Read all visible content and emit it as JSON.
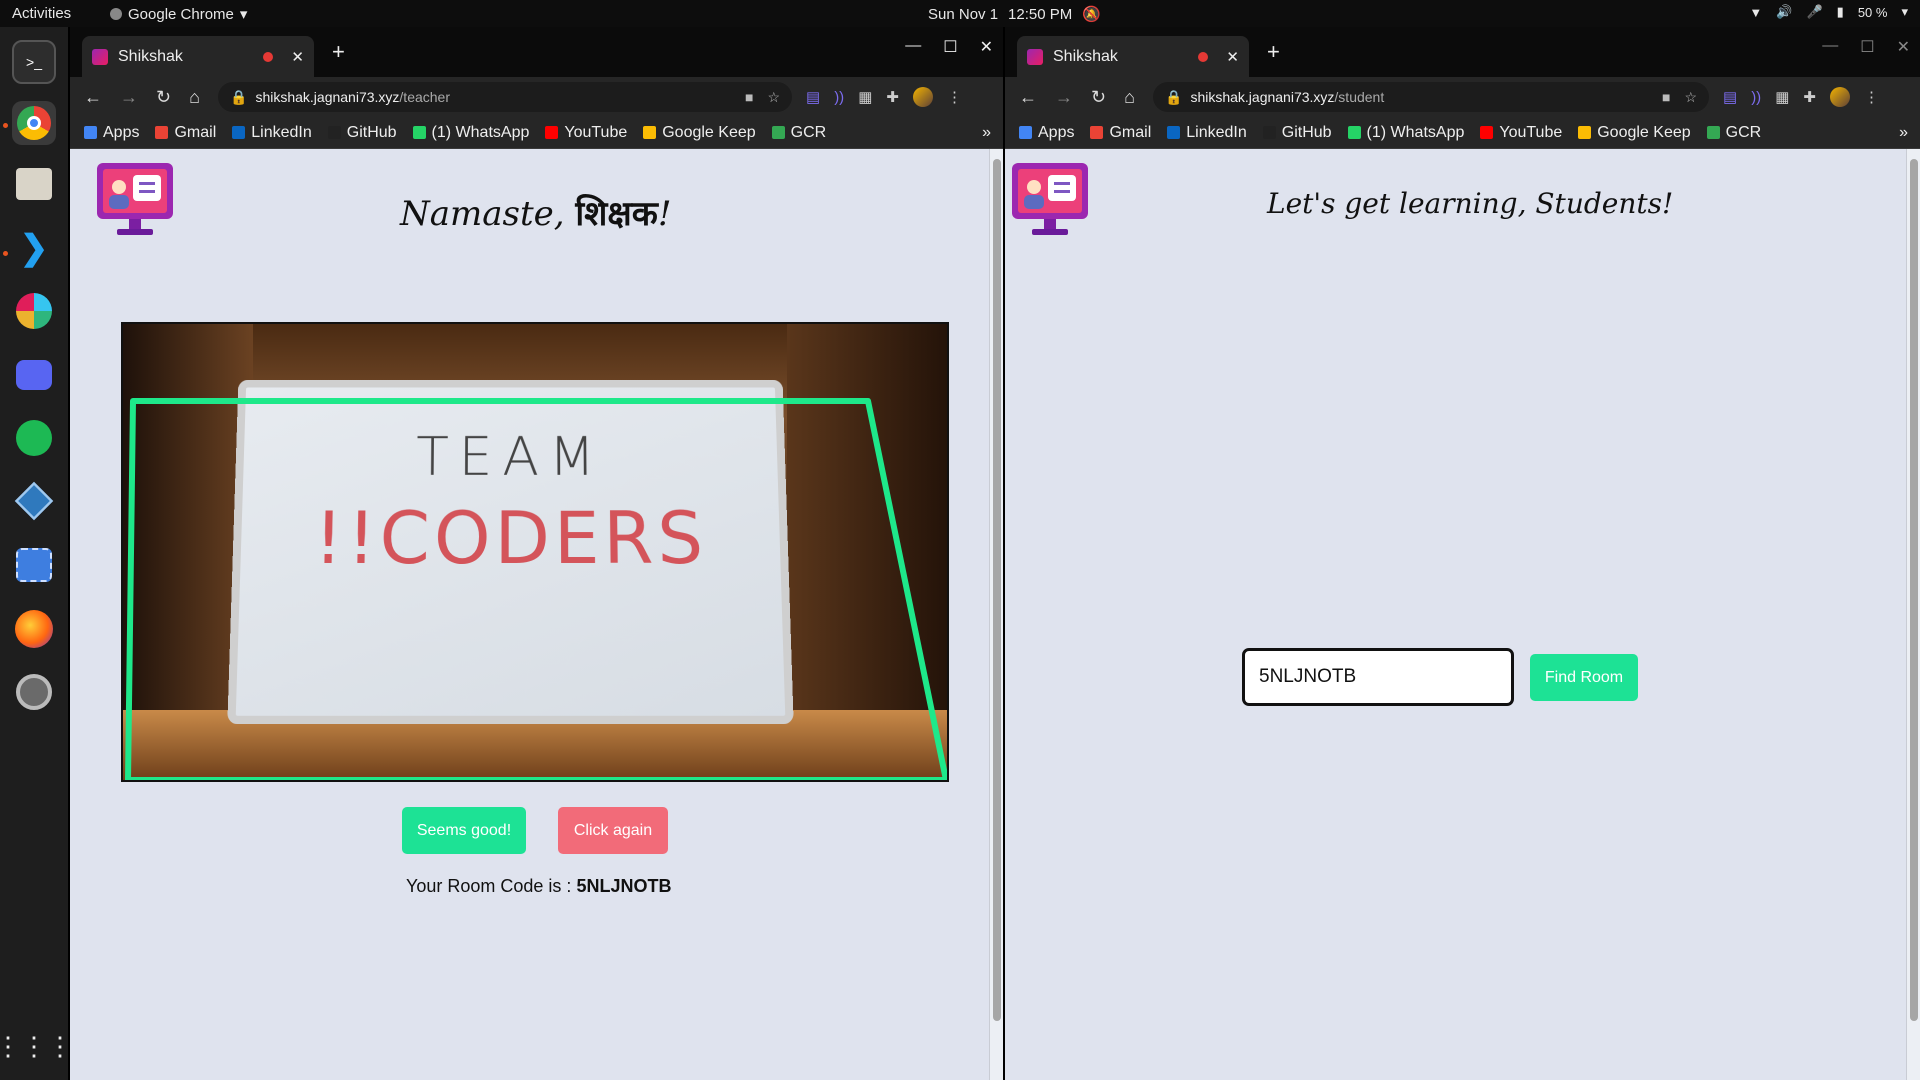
{
  "topbar": {
    "activities": "Activities",
    "app_name": "Google Chrome",
    "date": "Sun Nov 1",
    "time": "12:50 PM",
    "battery": "50 %"
  },
  "dock": {
    "items": [
      "terminal-icon",
      "chrome-icon",
      "files-icon",
      "vscode-icon",
      "slack-icon",
      "discord-icon",
      "spotify-icon",
      "virtualbox-icon",
      "screenshot-icon",
      "firefox-icon",
      "settings-icon",
      "app-grid-icon"
    ]
  },
  "left_window": {
    "tab_title": "Shikshak",
    "url_host": "shikshak.jagnani73.xyz",
    "url_path": "/teacher",
    "heading_prefix": "Namaste, ",
    "heading_word": "शिक्षक",
    "heading_suffix": "!",
    "board_line1": "TEAM",
    "board_line2": "!!CODERS",
    "btn_good": "Seems good!",
    "btn_again": "Click again",
    "room_code_label": "Your Room Code is :",
    "room_code": "5NLJNOTB"
  },
  "right_window": {
    "tab_title": "Shikshak",
    "url_host": "shikshak.jagnani73.xyz",
    "url_path": "/student",
    "heading": "Let's get learning, Students!",
    "input_value": "5NLJNOTB",
    "btn_find": "Find Room"
  },
  "bookmarks": [
    {
      "label": "Apps",
      "color": "#4285f4"
    },
    {
      "label": "Gmail",
      "color": "#ea4335"
    },
    {
      "label": "LinkedIn",
      "color": "#0a66c2"
    },
    {
      "label": "GitHub",
      "color": "#222222"
    },
    {
      "label": "(1) WhatsApp",
      "color": "#25d366"
    },
    {
      "label": "YouTube",
      "color": "#ff0000"
    },
    {
      "label": "Google Keep",
      "color": "#fbbc04"
    },
    {
      "label": "GCR",
      "color": "#34a853"
    }
  ],
  "colors": {
    "accent_green": "#1de295",
    "accent_red": "#f26b79",
    "detect_outline": "#1ee88a",
    "page_bg": "#dfe3ee"
  }
}
